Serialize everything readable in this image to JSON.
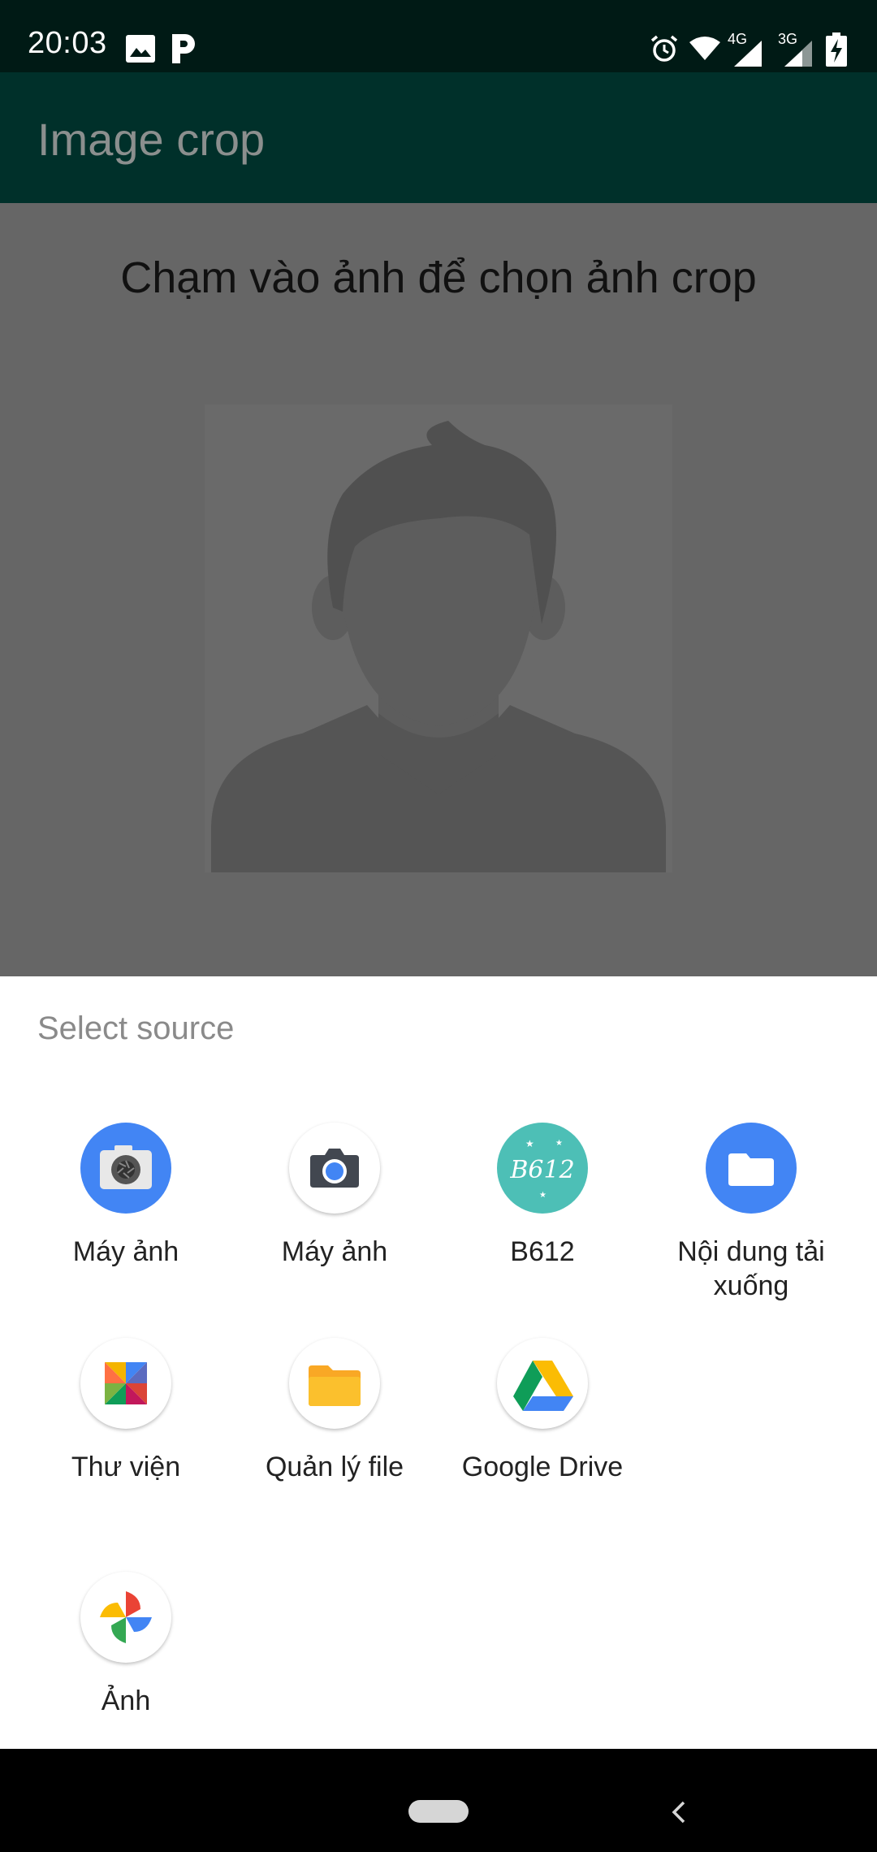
{
  "status_bar": {
    "time": "20:03",
    "network_4g": "4G",
    "network_3g": "3G",
    "icons": [
      "gallery-icon",
      "p-app-icon",
      "alarm-icon",
      "wifi-icon",
      "signal-icon",
      "signal-icon",
      "battery-charging-icon"
    ]
  },
  "toolbar": {
    "title": "Image crop"
  },
  "content": {
    "instruction": "Chạm vào ảnh để chọn ảnh crop",
    "avatar_icon": "person-placeholder-icon"
  },
  "sheet": {
    "title": "Select source",
    "apps": [
      {
        "label": "Máy ảnh",
        "icon": "camera-aperture-icon"
      },
      {
        "label": "Máy ảnh",
        "icon": "camera-icon"
      },
      {
        "label": "B612",
        "icon": "b612-icon"
      },
      {
        "label": "Nội dung tải xuống",
        "icon": "folder-icon"
      },
      {
        "label": "Thư viện",
        "icon": "pinwheel-gallery-icon"
      },
      {
        "label": "Quản lý file",
        "icon": "file-manager-icon"
      },
      {
        "label": "Google Drive",
        "icon": "google-drive-icon"
      },
      {
        "label": "Ảnh",
        "icon": "google-photos-icon"
      }
    ]
  },
  "colors": {
    "status_bar": "#001a15",
    "toolbar": "#00302a",
    "scrim_content": "#666666",
    "sheet_bg": "#ffffff"
  }
}
